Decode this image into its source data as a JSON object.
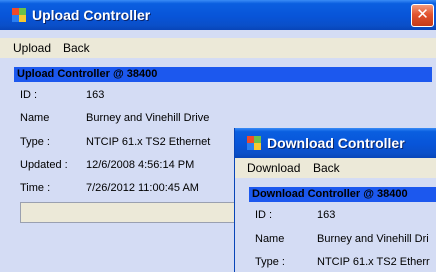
{
  "upload_window": {
    "title": "Upload Controller",
    "close_glyph": "✕",
    "menu": [
      "Upload",
      "Back"
    ],
    "header": "Upload Controller @ 38400",
    "fields": [
      {
        "label": "ID :",
        "value": "163"
      },
      {
        "label": "Name",
        "value": "Burney and Vinehill Drive"
      },
      {
        "label": "Type :",
        "value": "NTCIP 61.x TS2 Ethernet"
      },
      {
        "label": "Updated :",
        "value": "12/6/2008 4:56:14 PM"
      },
      {
        "label": "Time :",
        "value": "7/26/2012 11:00:45 AM"
      }
    ]
  },
  "download_window": {
    "title": "Download Controller",
    "menu": [
      "Download",
      "Back"
    ],
    "header": "Download Controller @ 38400",
    "fields": [
      {
        "label": "ID :",
        "value": "163"
      },
      {
        "label": "Name",
        "value": "Burney and Vinehill Dri"
      },
      {
        "label": "Type :",
        "value": "NTCIP 61.x TS2 Etherr"
      }
    ]
  },
  "colors": {
    "titlebar": "#0854d8",
    "header": "#1c58ee",
    "panel": "#d4dcf4",
    "menubar": "#ece9d8",
    "close": "#e2532e"
  }
}
